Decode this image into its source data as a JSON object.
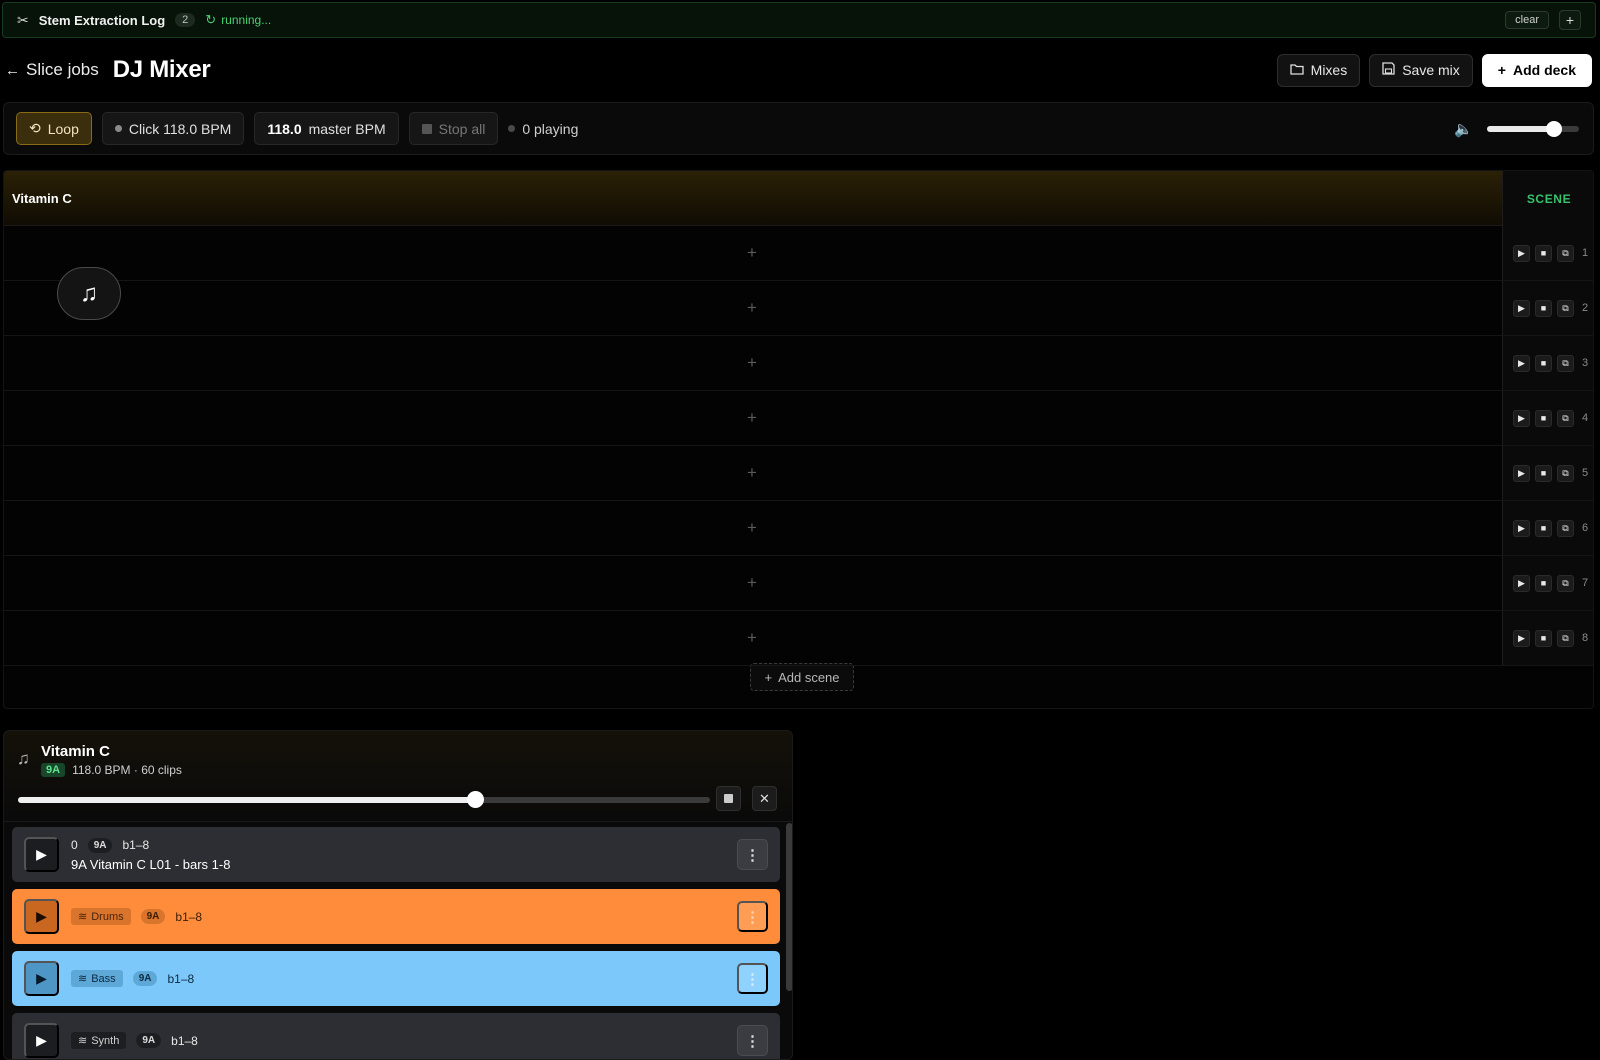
{
  "log": {
    "title": "Stem Extraction Log",
    "count": "2",
    "status": "running...",
    "clear_label": "clear",
    "add_label": "+"
  },
  "header": {
    "back_label": "Slice jobs",
    "title": "DJ Mixer",
    "mixes_label": "Mixes",
    "save_label": "Save mix",
    "add_deck_label": "Add deck"
  },
  "transport": {
    "loop_label": "Loop",
    "click_label": "Click 118.0 BPM",
    "master_bpm_value": "118.0",
    "master_bpm_label": "master BPM",
    "stop_all_label": "Stop all",
    "playing_label": "0 playing",
    "volume": 0.73
  },
  "grid": {
    "deck_name": "Vitamin C",
    "scene_header": "SCENE",
    "cell_add_glyph": "+",
    "scenes": [
      "1",
      "2",
      "3",
      "4",
      "5",
      "6",
      "7",
      "8"
    ],
    "add_scene_label": "Add scene"
  },
  "deck": {
    "name": "Vitamin C",
    "key": "9A",
    "meta": "118.0 BPM · 60 clips",
    "position": 0.66,
    "clips": [
      {
        "index": "0",
        "key": "9A",
        "range": "b1–8",
        "title": "9A Vitamin C L01 - bars 1-8",
        "color": "grey"
      },
      {
        "stem": "Drums",
        "key": "9A",
        "range": "b1–8",
        "color": "orange"
      },
      {
        "stem": "Bass",
        "key": "9A",
        "range": "b1–8",
        "color": "blue"
      },
      {
        "stem": "Synth",
        "key": "9A",
        "range": "b1–8",
        "color": "grey"
      }
    ]
  },
  "colors": {
    "accent_green": "#37c16b",
    "loop_gold": "#8a6a14",
    "drums_orange": "#ff8c3a",
    "bass_blue": "#7cc8fb"
  }
}
